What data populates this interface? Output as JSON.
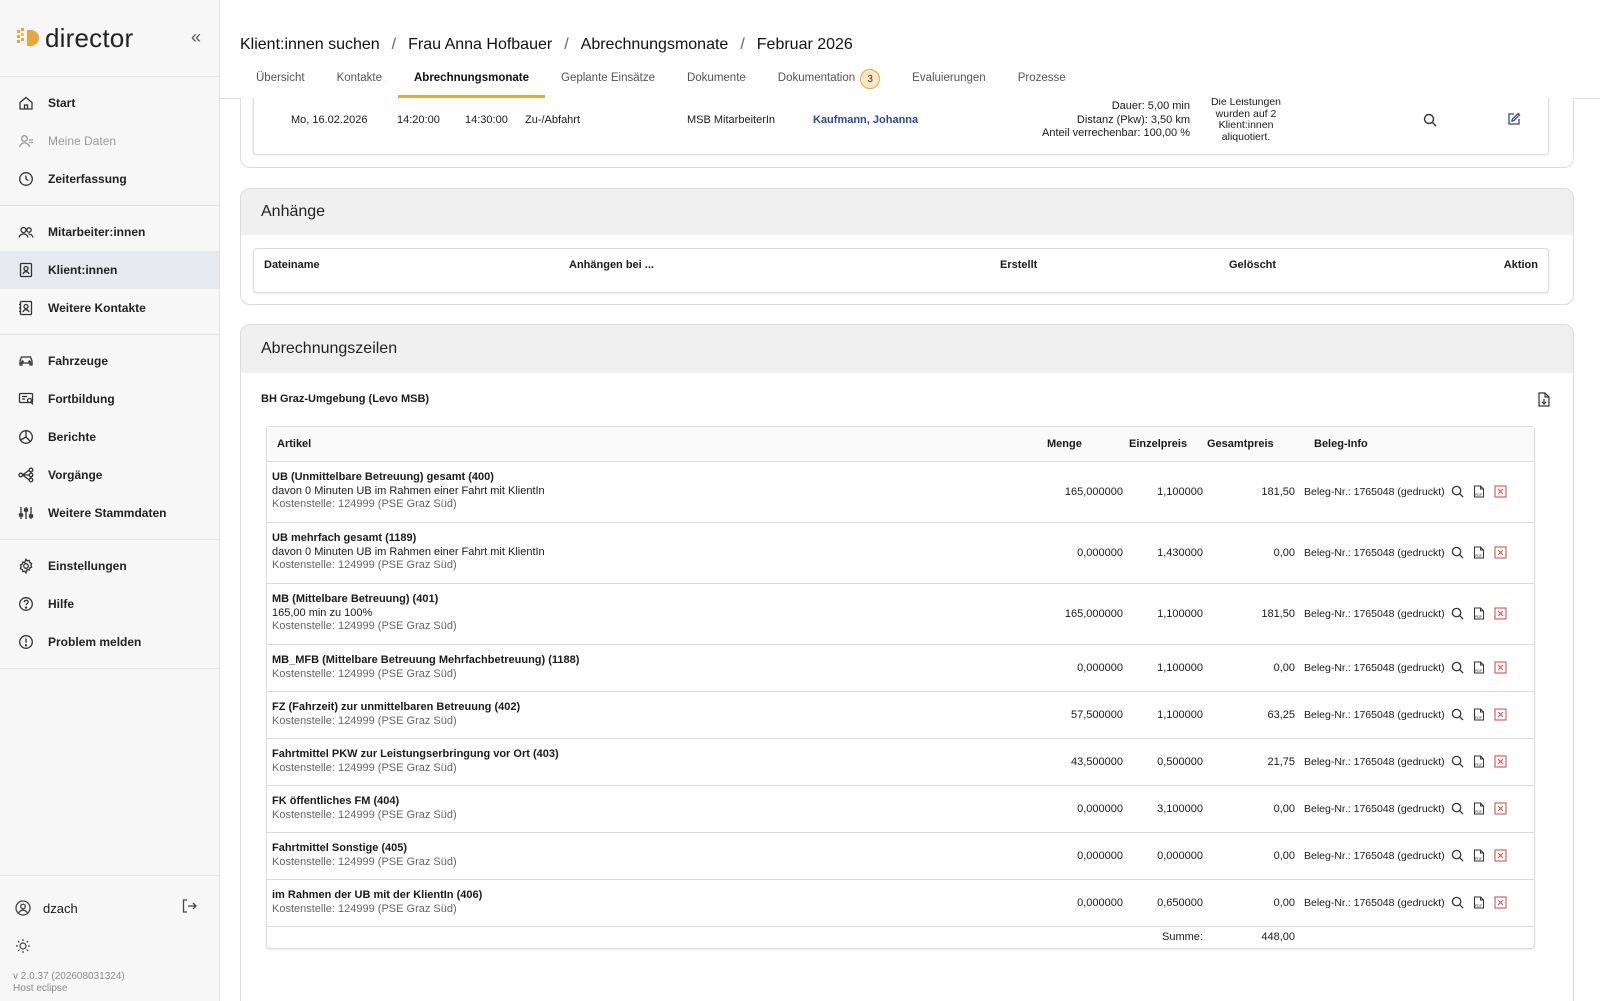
{
  "app": {
    "name": "director",
    "user": "dzach",
    "version": "v 2.0.37 (202608031324)",
    "host": "Host eclipse"
  },
  "sidebar": {
    "groups": [
      [
        {
          "label": "Start",
          "icon": "home-icon"
        },
        {
          "label": "Meine Daten",
          "icon": "user-icon",
          "disabled": true
        },
        {
          "label": "Zeiterfassung",
          "icon": "clock-icon"
        }
      ],
      [
        {
          "label": "Mitarbeiter:innen",
          "icon": "users-icon"
        },
        {
          "label": "Klient:innen",
          "icon": "client-icon",
          "active": true
        },
        {
          "label": "Weitere Kontakte",
          "icon": "contacts-icon"
        }
      ],
      [
        {
          "label": "Fahrzeuge",
          "icon": "car-icon"
        },
        {
          "label": "Fortbildung",
          "icon": "training-icon"
        },
        {
          "label": "Berichte",
          "icon": "reports-icon"
        },
        {
          "label": "Vorgänge",
          "icon": "workflow-icon"
        },
        {
          "label": "Weitere Stammdaten",
          "icon": "sliders-icon"
        }
      ],
      [
        {
          "label": "Einstellungen",
          "icon": "gear-icon"
        },
        {
          "label": "Hilfe",
          "icon": "help-icon"
        },
        {
          "label": "Problem melden",
          "icon": "alert-icon"
        }
      ]
    ]
  },
  "breadcrumb": [
    "Klient:innen suchen",
    "Frau Anna Hofbauer",
    "Abrechnungsmonate",
    "Februar 2026"
  ],
  "tabs": [
    {
      "label": "Übersicht"
    },
    {
      "label": "Kontakte"
    },
    {
      "label": "Abrechnungsmonate",
      "active": true
    },
    {
      "label": "Geplante Einsätze"
    },
    {
      "label": "Dokumente"
    },
    {
      "label": "Dokumentation",
      "badge": "3"
    },
    {
      "label": "Evaluierungen"
    },
    {
      "label": "Prozesse"
    }
  ],
  "visit": {
    "date": "Mo, 16.02.2026",
    "start": "14:20:00",
    "end": "14:30:00",
    "type": "Zu-/Abfahrt",
    "role": "MSB MitarbeiterIn",
    "employee": "Kaufmann, Johanna",
    "duration": "Dauer: 5,00 min",
    "distance": "Distanz (Pkw): 3,50 km",
    "share": "Anteil verrechenbar: 100,00 %",
    "note": "Die Leistungen wurden auf 2 Klient:innen aliquotiert."
  },
  "attachments": {
    "title": "Anhänge",
    "columns": [
      "Dateiname",
      "Anhängen bei ...",
      "Erstellt",
      "Gelöscht",
      "Aktion"
    ]
  },
  "billing": {
    "title": "Abrechnungszeilen",
    "group": "BH Graz-Umgebung (Levo MSB)",
    "columns": {
      "artikel": "Artikel",
      "menge": "Menge",
      "einzelpreis": "Einzelpreis",
      "gesamtpreis": "Gesamtpreis",
      "beleg": "Beleg-Info"
    },
    "rows": [
      {
        "title": "UB (Unmittelbare Betreuung) gesamt (400)",
        "detail": "davon 0 Minuten UB im Rahmen einer Fahrt mit KlientIn",
        "cost": "Kostenstelle: 124999 (PSE Graz Süd)",
        "menge": "165,000000",
        "einzel": "1,100000",
        "gesamt": "181,50",
        "beleg": "Beleg-Nr.: 1765048 (gedruckt)"
      },
      {
        "title": "UB mehrfach gesamt (1189)",
        "detail": "davon 0 Minuten UB im Rahmen einer Fahrt mit KlientIn",
        "cost": "Kostenstelle: 124999 (PSE Graz Süd)",
        "menge": "0,000000",
        "einzel": "1,430000",
        "gesamt": "0,00",
        "beleg": "Beleg-Nr.: 1765048 (gedruckt)"
      },
      {
        "title": "MB (Mittelbare Betreuung) (401)",
        "detail": "165,00 min zu 100%",
        "cost": "Kostenstelle: 124999 (PSE Graz Süd)",
        "menge": "165,000000",
        "einzel": "1,100000",
        "gesamt": "181,50",
        "beleg": "Beleg-Nr.: 1765048 (gedruckt)"
      },
      {
        "title": "MB_MFB (Mittelbare Betreuung Mehrfachbetreuung) (1188)",
        "detail": "",
        "cost": "Kostenstelle: 124999 (PSE Graz Süd)",
        "menge": "0,000000",
        "einzel": "1,100000",
        "gesamt": "0,00",
        "beleg": "Beleg-Nr.: 1765048 (gedruckt)"
      },
      {
        "title": "FZ (Fahrzeit) zur unmittelbaren Betreuung (402)",
        "detail": "",
        "cost": "Kostenstelle: 124999 (PSE Graz Süd)",
        "menge": "57,500000",
        "einzel": "1,100000",
        "gesamt": "63,25",
        "beleg": "Beleg-Nr.: 1765048 (gedruckt)"
      },
      {
        "title": "Fahrtmittel PKW zur Leistungserbringung vor Ort (403)",
        "detail": "",
        "cost": "Kostenstelle: 124999 (PSE Graz Süd)",
        "menge": "43,500000",
        "einzel": "0,500000",
        "gesamt": "21,75",
        "beleg": "Beleg-Nr.: 1765048 (gedruckt)"
      },
      {
        "title": "FK öffentliches FM (404)",
        "detail": "",
        "cost": "Kostenstelle: 124999 (PSE Graz Süd)",
        "menge": "0,000000",
        "einzel": "3,100000",
        "gesamt": "0,00",
        "beleg": "Beleg-Nr.: 1765048 (gedruckt)"
      },
      {
        "title": "Fahrtmittel Sonstige (405)",
        "detail": "",
        "cost": "Kostenstelle: 124999 (PSE Graz Süd)",
        "menge": "0,000000",
        "einzel": "0,000000",
        "gesamt": "0,00",
        "beleg": "Beleg-Nr.: 1765048 (gedruckt)"
      },
      {
        "title": "im Rahmen der UB mit der KlientIn (406)",
        "detail": "",
        "cost": "Kostenstelle: 124999 (PSE Graz Süd)",
        "menge": "0,000000",
        "einzel": "0,650000",
        "gesamt": "0,00",
        "beleg": "Beleg-Nr.: 1765048 (gedruckt)"
      }
    ],
    "sum_label": "Summe:",
    "sum_value": "448,00"
  },
  "colors": {
    "accent": "#e8a640",
    "link": "#2846a8",
    "delete": "#d9534f",
    "active_nav": "#e6e9f0"
  }
}
